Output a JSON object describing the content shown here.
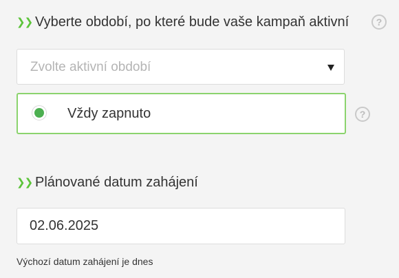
{
  "period_section": {
    "title": "Vyberte období, po které bude vaše kampaň aktivní",
    "select_placeholder": "Zvolte aktivní období",
    "selected_option": "Vždy zapnuto"
  },
  "start_section": {
    "title": "Plánované datum zahájení",
    "date_value": "02.06.2025",
    "hint": "Výchozí datum zahájení je dnes"
  },
  "icons": {
    "chevron": "double-chevron-right-icon",
    "help": "question-mark-circle-icon",
    "select_arrow": "caret-down-icon",
    "radio": "radio-selected-icon"
  },
  "colors": {
    "accent_green": "#5cc43a",
    "radio_green": "#4caf50",
    "option_border": "#8bd36d",
    "background": "#f4f4f4"
  }
}
